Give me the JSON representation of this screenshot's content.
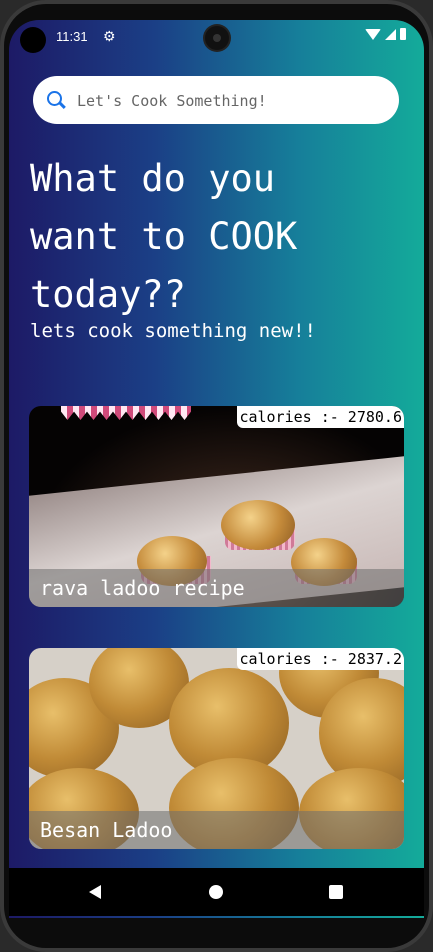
{
  "status": {
    "time": "11:31",
    "settings_icon": "gear-icon"
  },
  "search": {
    "placeholder": "Let's Cook Something!"
  },
  "header": {
    "title_line1": "What do you",
    "title_line2": "want to COOK",
    "title_line3": "today??",
    "subtitle": "lets cook something new!!"
  },
  "recipes": [
    {
      "name": "rava ladoo recipe",
      "calories": "calories :- 2780.6"
    },
    {
      "name": "Besan Ladoo",
      "calories": "calories :- 2837.2"
    }
  ],
  "colors": {
    "gradient_start": "#1d1a66",
    "gradient_end": "#14ab9a",
    "search_icon": "#1a73e8"
  }
}
